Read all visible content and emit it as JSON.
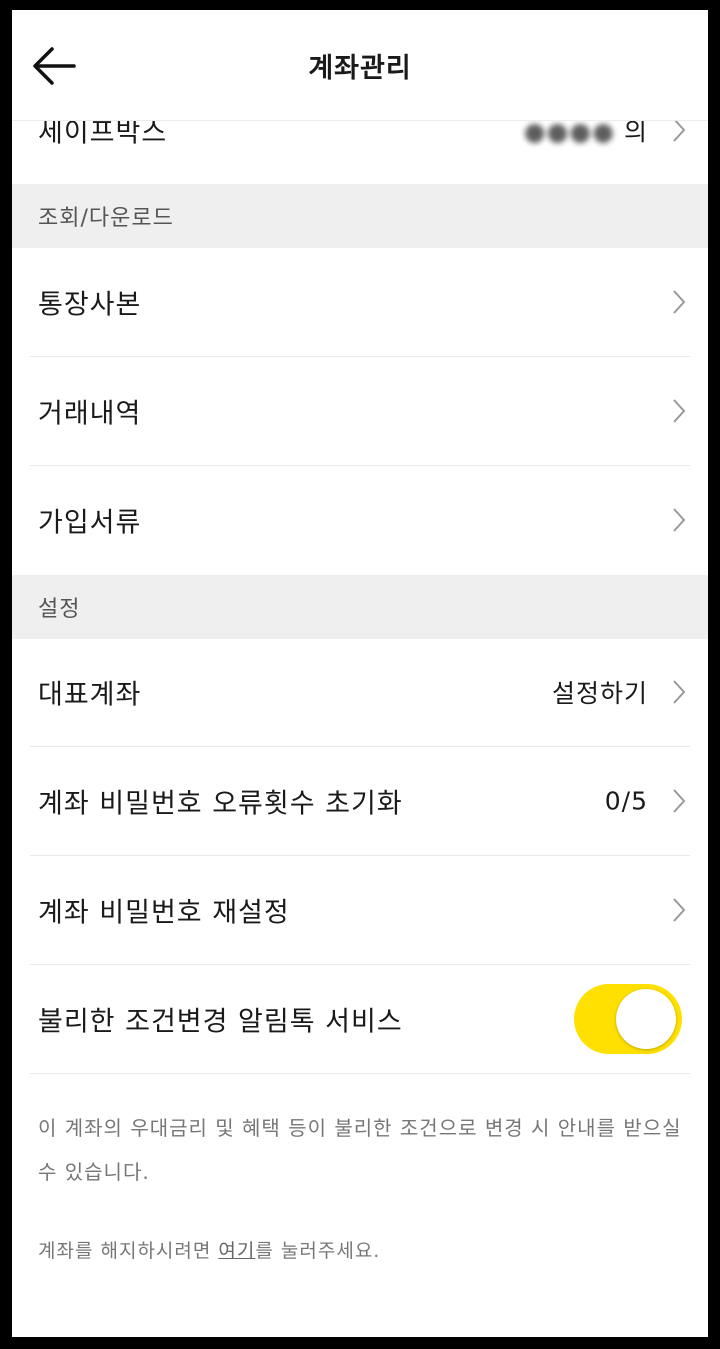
{
  "header": {
    "title": "계좌관리",
    "back_icon": "arrow-left-icon"
  },
  "partial_row": {
    "label": "세이프박스",
    "value": "의"
  },
  "sections": {
    "inquiry": {
      "title": "조회/다운로드"
    },
    "settings": {
      "title": "설정"
    }
  },
  "inquiry_items": [
    {
      "label": "통장사본"
    },
    {
      "label": "거래내역"
    },
    {
      "label": "가입서류"
    }
  ],
  "settings_items": [
    {
      "label": "대표계좌",
      "value": "설정하기"
    },
    {
      "label": "계좌 비밀번호 오류횟수 초기화",
      "value": "0/5"
    },
    {
      "label": "계좌 비밀번호 재설정"
    },
    {
      "label": "불리한 조건변경 알림톡 서비스",
      "toggle": "on"
    }
  ],
  "notice_text": "이 계좌의 우대금리 및 혜택 등이 불리한 조건으로 변경 시 안내를 받으실 수 있습니다.",
  "footer": {
    "before": "계좌를 해지하시려면 ",
    "link": "여기",
    "after": "를 눌러주세요."
  },
  "colors": {
    "accent": "#ffe000",
    "section_bg": "#efefef",
    "divider": "#e9e9e9"
  }
}
